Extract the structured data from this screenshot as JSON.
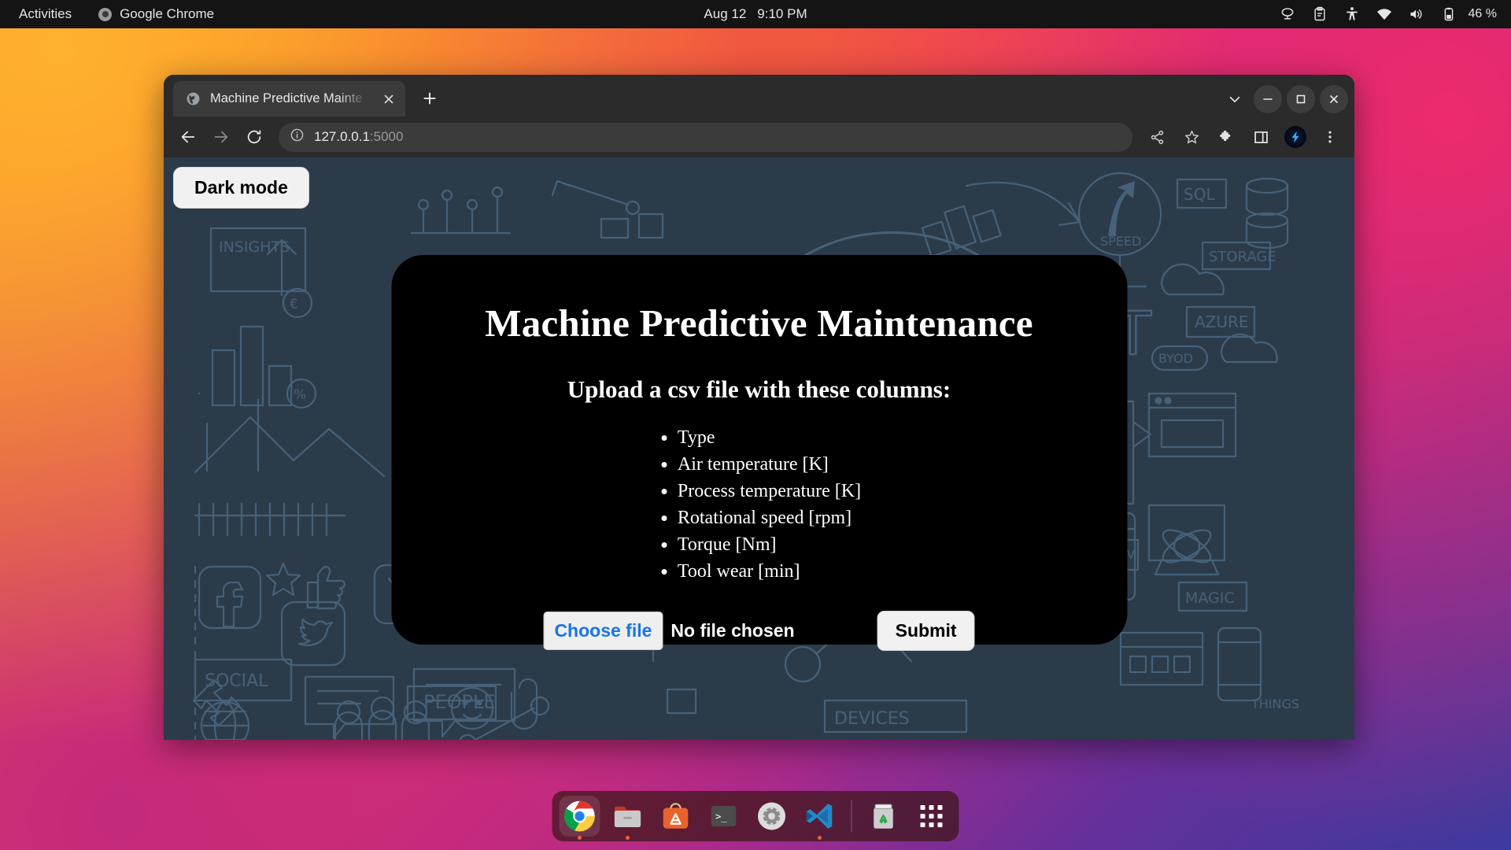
{
  "topbar": {
    "activities": "Activities",
    "app_name": "Google Chrome",
    "app_icon": "chrome-icon",
    "clock_date": "Aug 12",
    "clock_time": "9:10 PM",
    "tray": [
      {
        "name": "screencast-icon"
      },
      {
        "name": "clipboard-icon"
      },
      {
        "name": "accessibility-icon"
      },
      {
        "name": "wifi-icon"
      },
      {
        "name": "volume-icon"
      },
      {
        "name": "battery-icon"
      }
    ],
    "battery_percent": "46 %"
  },
  "browser": {
    "tab": {
      "title": "Machine Predictive Mainte",
      "favicon": "globe-icon",
      "close": "close-icon"
    },
    "new_tab": "+",
    "window_controls": {
      "tab_search": "chevron-down-icon",
      "minimize": "minimize-icon",
      "maximize": "maximize-icon",
      "close": "close-icon"
    },
    "toolbar": {
      "back": "back-arrow-icon",
      "forward": "forward-arrow-icon",
      "reload": "reload-icon",
      "site_info": "info-icon",
      "url_host": "127.0.0.1",
      "url_port": ":5000",
      "share": "share-icon",
      "bookmark": "star-icon",
      "extensions": "puzzle-icon",
      "side_panel": "side-panel-icon",
      "profile_extension": "lightning-bolt-extension-icon",
      "menu": "three-dot-menu-icon"
    }
  },
  "page": {
    "dark_mode_button": "Dark mode",
    "modal": {
      "title": "Machine Predictive Maintenance",
      "subtitle": "Upload a csv file with these columns:",
      "columns": [
        "Type",
        "Air temperature [K]",
        "Process temperature [K]",
        "Rotational speed [rpm]",
        "Torque [Nm]",
        "Tool wear [min]"
      ],
      "choose_file_label": "Choose file",
      "file_status": "No file chosen",
      "submit_label": "Submit"
    }
  },
  "dock": {
    "items": [
      {
        "name": "dock-item-chrome",
        "label": "Google Chrome"
      },
      {
        "name": "dock-item-files",
        "label": "Files"
      },
      {
        "name": "dock-item-software",
        "label": "Ubuntu Software"
      },
      {
        "name": "dock-item-terminal",
        "label": "Terminal"
      },
      {
        "name": "dock-item-settings",
        "label": "Settings"
      },
      {
        "name": "dock-item-vscode",
        "label": "Visual Studio Code"
      },
      {
        "name": "dock-item-trash",
        "label": "Trash"
      },
      {
        "name": "dock-item-appgrid",
        "label": "Show Applications"
      }
    ]
  },
  "colors": {
    "page_bg": "#2c3b4a",
    "modal_bg": "#000000",
    "doodle_line": "#5d809f",
    "accent_blue": "#1a73e8",
    "topbar_bg": "#141414",
    "browser_chrome": "#2b2b2b"
  }
}
